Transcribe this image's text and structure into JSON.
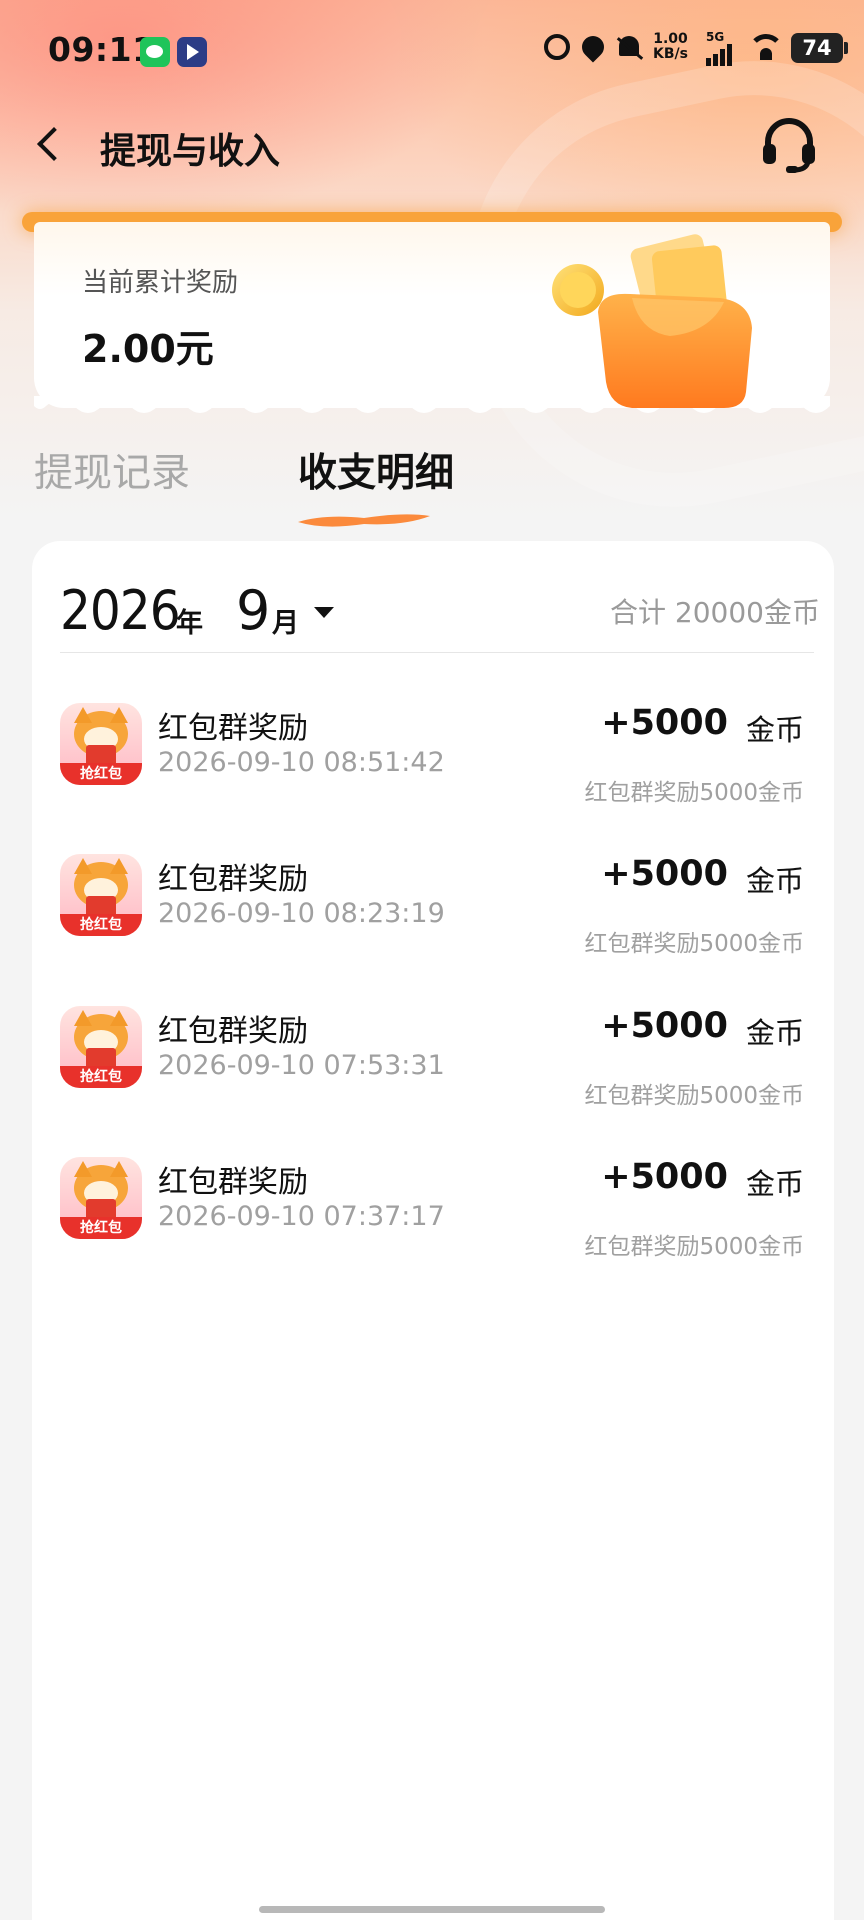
{
  "status_bar": {
    "time": "09:11",
    "net_speed_value": "1.00",
    "net_speed_unit": "KB/s",
    "network": "5G",
    "battery": "74",
    "icons": [
      "wechat-icon",
      "player-icon",
      "alarm-icon",
      "location-icon",
      "mute-bell-icon",
      "signal-icon",
      "wifi-icon",
      "battery-icon"
    ]
  },
  "header": {
    "title": "提现与收入",
    "back_icon": "chevron-left-icon",
    "support_icon": "headset-icon"
  },
  "reward": {
    "label": "当前累计奖励",
    "amount": "2.00元"
  },
  "tabs": [
    {
      "label": "提现记录",
      "active": false
    },
    {
      "label": "收支明细",
      "active": true
    }
  ],
  "filter": {
    "year": "2026",
    "year_unit": "年",
    "month": "9",
    "month_unit": "月",
    "total": "合计 20000金币"
  },
  "transactions": [
    {
      "title": "红包群奖励",
      "time": "2026-09-10 08:51:42",
      "amount": "+5000",
      "unit": "金币",
      "desc": "红包群奖励5000金币",
      "icon_label": "抢红包"
    },
    {
      "title": "红包群奖励",
      "time": "2026-09-10 08:23:19",
      "amount": "+5000",
      "unit": "金币",
      "desc": "红包群奖励5000金币",
      "icon_label": "抢红包"
    },
    {
      "title": "红包群奖励",
      "time": "2026-09-10 07:53:31",
      "amount": "+5000",
      "unit": "金币",
      "desc": "红包群奖励5000金币",
      "icon_label": "抢红包"
    },
    {
      "title": "红包群奖励",
      "time": "2026-09-10 07:37:17",
      "amount": "+5000",
      "unit": "金币",
      "desc": "红包群奖励5000金币",
      "icon_label": "抢红包"
    }
  ],
  "colors": {
    "accent_orange": "#f9a33a",
    "header_gradient_top": "#fbb79b",
    "muted_text": "#a0a0a0"
  }
}
